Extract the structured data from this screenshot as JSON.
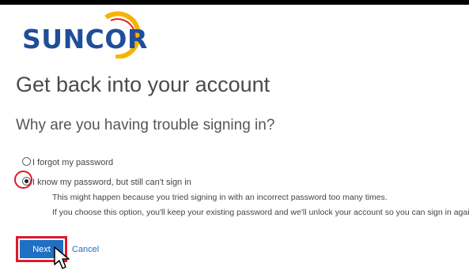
{
  "brand": {
    "logo_text": "SUNCOR",
    "accent_color": "#f2a900",
    "text_color": "#1f4e9a"
  },
  "page": {
    "heading": "Get back into your account",
    "subheading": "Why are you having trouble signing in?"
  },
  "options": [
    {
      "label": "I forgot my password",
      "selected": false
    },
    {
      "label": "I know my password, but still can't sign in",
      "selected": true,
      "description": [
        "This might happen because you tried signing in with an incorrect password too many times.",
        "If you choose this option, you'll keep your existing password and we'll unlock your account so you can sign in again."
      ]
    }
  ],
  "actions": {
    "next_label": "Next",
    "cancel_label": "Cancel"
  },
  "colors": {
    "button_blue": "#1f6fc3",
    "highlight_red": "#e0182d"
  }
}
